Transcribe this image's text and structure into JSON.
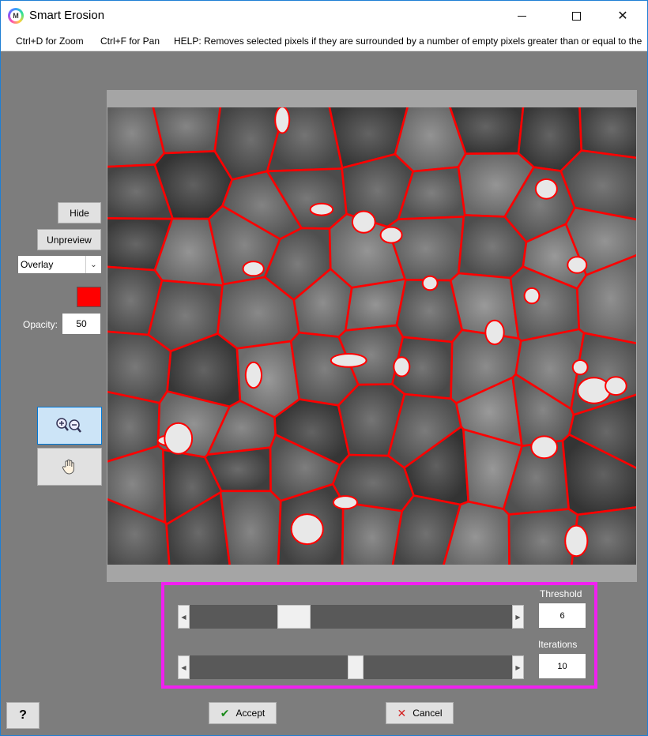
{
  "window": {
    "title": "Smart Erosion",
    "app_icon_letter": "M",
    "controls": {
      "minimize": "minimize",
      "maximize": "maximize",
      "close": "✕"
    }
  },
  "menubar": {
    "zoom_hint": "Ctrl+D for Zoom",
    "pan_hint": "Ctrl+F for Pan",
    "help_text": "HELP:  Removes selected pixels if they are surrounded by a number of empty pixels greater than or equal to the"
  },
  "panel": {
    "hide_label": "Hide",
    "unpreview_label": "Unpreview",
    "overlay_mode": "Overlay",
    "overlay_color": "#ff0000",
    "opacity_label": "Opacity:",
    "opacity_value": "50",
    "zoom_tool_icon": "zoom-in-out-icon",
    "pan_tool_icon": "hand-pan-icon"
  },
  "params": {
    "threshold": {
      "label": "Threshold",
      "value": "6",
      "slider_fraction": 0.28
    },
    "iterations": {
      "label": "Iterations",
      "value": "10",
      "slider_fraction": 0.5
    }
  },
  "footer": {
    "accept_label": "Accept",
    "cancel_label": "Cancel",
    "help_label": "?"
  },
  "colors": {
    "highlight_border": "#f020f0",
    "overlay_red": "#ff0000",
    "window_bg": "#7d7d7d"
  }
}
